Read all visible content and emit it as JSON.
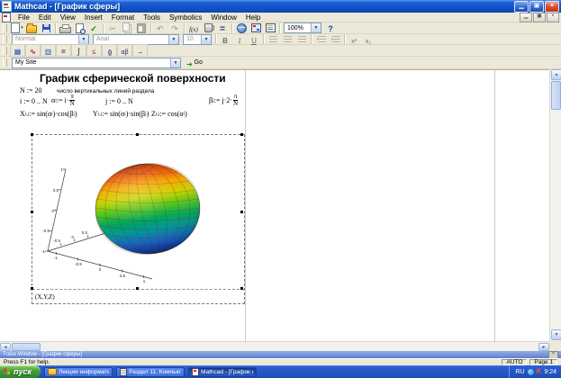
{
  "window": {
    "title": "Mathcad - [График сферы]",
    "menu": [
      "File",
      "Edit",
      "View",
      "Insert",
      "Format",
      "Tools",
      "Symbolics",
      "Window",
      "Help"
    ]
  },
  "toolbar": {
    "standard_icons": [
      "new",
      "open",
      "save",
      "print",
      "print-preview",
      "check-spelling",
      "cut",
      "copy",
      "paste",
      "undo",
      "redo",
      "insert-function",
      "insert-unit",
      "calculate",
      "insert-hyperlink",
      "insert-component",
      "resource-center",
      "zoom",
      "help"
    ],
    "zoom_value": "100%",
    "style_value": "Normal",
    "font_value": "Arial",
    "size_value": "10",
    "math_icons": [
      "calculator",
      "graph",
      "matrix",
      "evaluation",
      "calculus",
      "boolean",
      "programming",
      "greek",
      "symbolic"
    ],
    "resources_value": "My Site",
    "go_label": "Go"
  },
  "doc": {
    "title": "График сферической поверхности",
    "n_def": "N := 20",
    "n_comment": "число вертикальных линий раздела",
    "range_i": "i := 0 .. N",
    "range_j": "j := 0 .. N",
    "alpha": {
      "base": "α",
      "sub": "i",
      "mid": " := i·",
      "num": "π",
      "den": "N"
    },
    "beta": {
      "base": "β",
      "sub": "j",
      "mid": " := j·2·",
      "num": "π",
      "den": "N"
    },
    "X": {
      "base": "X",
      "sub": "i,j",
      "m1": " := sin(α",
      "s1": "i",
      "m2": ")·cos(β",
      "s2": "j",
      "m3": ")"
    },
    "Y": {
      "base": "Y",
      "sub": "i,j",
      "m1": " := sin(α",
      "s1": "i",
      "m2": ")·sin(β",
      "s2": "j",
      "m3": ")"
    },
    "Z": {
      "base": "Z",
      "sub": "i,j",
      "m1": " := cos(α",
      "s1": "i",
      "m3": ")"
    }
  },
  "chart_data": {
    "type": "surface3d",
    "title": "",
    "function_label": "(X,Y,Z)",
    "description": "Unit sphere surface plot: X=sin(α)·cos(β), Y=sin(α)·sin(β), Z=cos(α); α=i·π/N, β=j·2·π/N, i,j=0..N, N=20",
    "axes": {
      "z": {
        "ticks": [
          "1",
          "0.5",
          "0",
          "-0.5",
          "-1"
        ],
        "range": [
          -1,
          1
        ]
      },
      "x": {
        "ticks": [
          "-1",
          "-0.5",
          "0",
          "0.5",
          "1"
        ],
        "range": [
          -1,
          1
        ]
      },
      "y": {
        "ticks": [
          "-0.5",
          "0",
          "0.5"
        ],
        "range": [
          -1,
          1
        ]
      }
    },
    "grid_lines": 20,
    "colormap": [
      "#b62e12",
      "#e85b0b",
      "#f6a600",
      "#cad400",
      "#55c41e",
      "#00a65a",
      "#00939b",
      "#1261c4",
      "#0a2e9e"
    ],
    "legend": "off"
  },
  "trace_window": {
    "title": "Trace Window - [График сферы]"
  },
  "status": {
    "help": "Press F1 for help.",
    "auto": "AUTO",
    "page": "Page 1"
  },
  "taskbar": {
    "start": "пуск",
    "tasks": [
      "Лекции информатика",
      "Раздел 11. Компьют...",
      "Mathcad - [График с..."
    ],
    "tray": {
      "lang": "RU",
      "time": "9:24"
    }
  }
}
